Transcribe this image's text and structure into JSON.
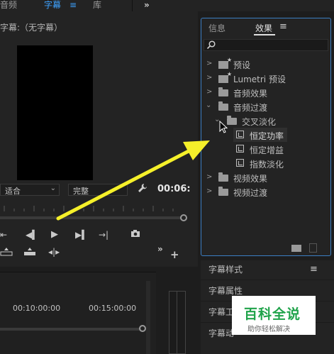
{
  "topbar": {
    "tab_audio": "音频",
    "tab_captions": "字幕",
    "tab_captions_menu": "≡",
    "tab_library": "库",
    "more": "»"
  },
  "monitor": {
    "title": "字幕:（无字幕）",
    "fit_value": "适合",
    "quality_value": "完整",
    "timecode": "00:06:"
  },
  "timeline": {
    "tick1": "00:10:00:00",
    "tick2": "00:15:00:00"
  },
  "effects_panel": {
    "tab_info": "信息",
    "tab_effects": "效果",
    "menu": "≡",
    "search_placeholder": "",
    "tree": {
      "presets": "预设",
      "lumetri_presets": "Lumetri 预设",
      "audio_effects": "音频效果",
      "audio_transitions": "音频过渡",
      "crossfade": "交叉淡化",
      "constant_power": "恒定功率",
      "constant_gain": "恒定增益",
      "exponential_fade": "指数淡化",
      "video_effects": "视频效果",
      "video_transitions": "视频过渡"
    }
  },
  "captions_panel": {
    "style": "字幕样式",
    "menu": "≡",
    "properties": "字幕属性",
    "tools": "字幕工",
    "actions": "字幕动"
  },
  "watermark": {
    "title": "百科全说",
    "subtitle": "助你轻松解决"
  },
  "colors": {
    "accent_blue": "#3ea2ff",
    "panel_border": "#3b7fc4",
    "arrow_yellow": "#f5f02a",
    "watermark_green": "#1fa34a"
  }
}
